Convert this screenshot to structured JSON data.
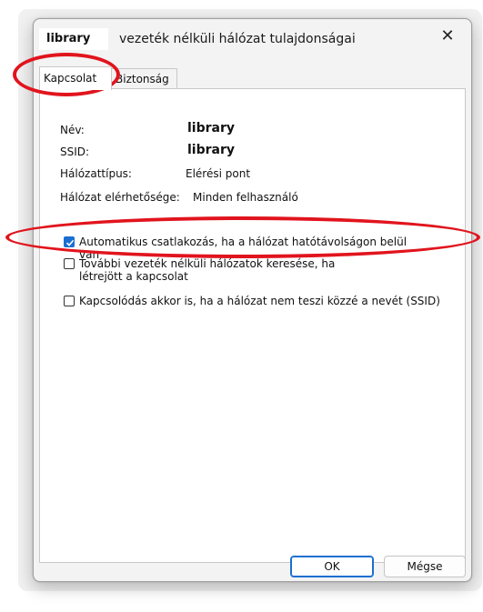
{
  "window": {
    "title_name": "library",
    "title_rest": "vezeték nélküli hálózat tulajdonságai",
    "close_glyph": "✕"
  },
  "tabs": [
    {
      "label": "Kapcsolat",
      "active": true
    },
    {
      "label": "Biztonság",
      "active": false
    }
  ],
  "info": {
    "name_label": "Név:",
    "name_value": "library",
    "ssid_label": "SSID:",
    "ssid_value": "library",
    "type_label": "Hálózattípus:",
    "type_value": "Elérési pont",
    "avail_label": "Hálózat elérhetősége:",
    "avail_value": "Minden felhasználó"
  },
  "options": [
    {
      "label": "Automatikus csatlakozás, ha a hálózat hatótávolságon belül van",
      "checked": true
    },
    {
      "label": "További vezeték nélküli hálózatok keresése, ha létrejött a kapcsolat",
      "checked": false
    },
    {
      "label": "Kapcsolódás akkor is, ha a hálózat nem teszi közzé a nevét (SSID)",
      "checked": false
    }
  ],
  "buttons": {
    "ok": "OK",
    "cancel": "Mégse"
  },
  "colors": {
    "accent": "#1a6fd1",
    "annotation": "#e1141d"
  }
}
